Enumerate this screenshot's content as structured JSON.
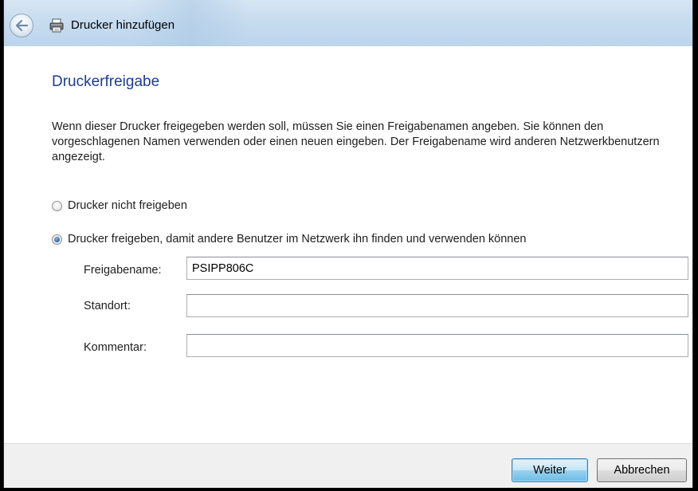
{
  "window": {
    "title": "Drucker hinzufügen"
  },
  "page": {
    "heading": "Druckerfreigabe",
    "description": "Wenn dieser Drucker freigegeben werden soll, müssen Sie einen Freigabenamen angeben. Sie können den vorgeschlagenen Namen verwenden oder einen neuen eingeben. Der Freigabename wird anderen Netzwerkbenutzern angezeigt."
  },
  "options": {
    "no_share": {
      "label": "Drucker nicht freigeben",
      "selected": false
    },
    "share": {
      "label": "Drucker freigeben, damit andere Benutzer im Netzwerk ihn finden und verwenden können",
      "selected": true
    }
  },
  "fields": {
    "share_name": {
      "label": "Freigabename:",
      "value": "PSIPP806C"
    },
    "location": {
      "label": "Standort:",
      "value": ""
    },
    "comment": {
      "label": "Kommentar:",
      "value": ""
    }
  },
  "buttons": {
    "next": "Weiter",
    "cancel": "Abbrechen"
  },
  "colors": {
    "heading": "#1d3d8f",
    "titlebar": "#c7dcef",
    "footer": "#f0f0f0"
  },
  "icons": {
    "back": "back-arrow-icon",
    "printer": "printer-icon"
  }
}
